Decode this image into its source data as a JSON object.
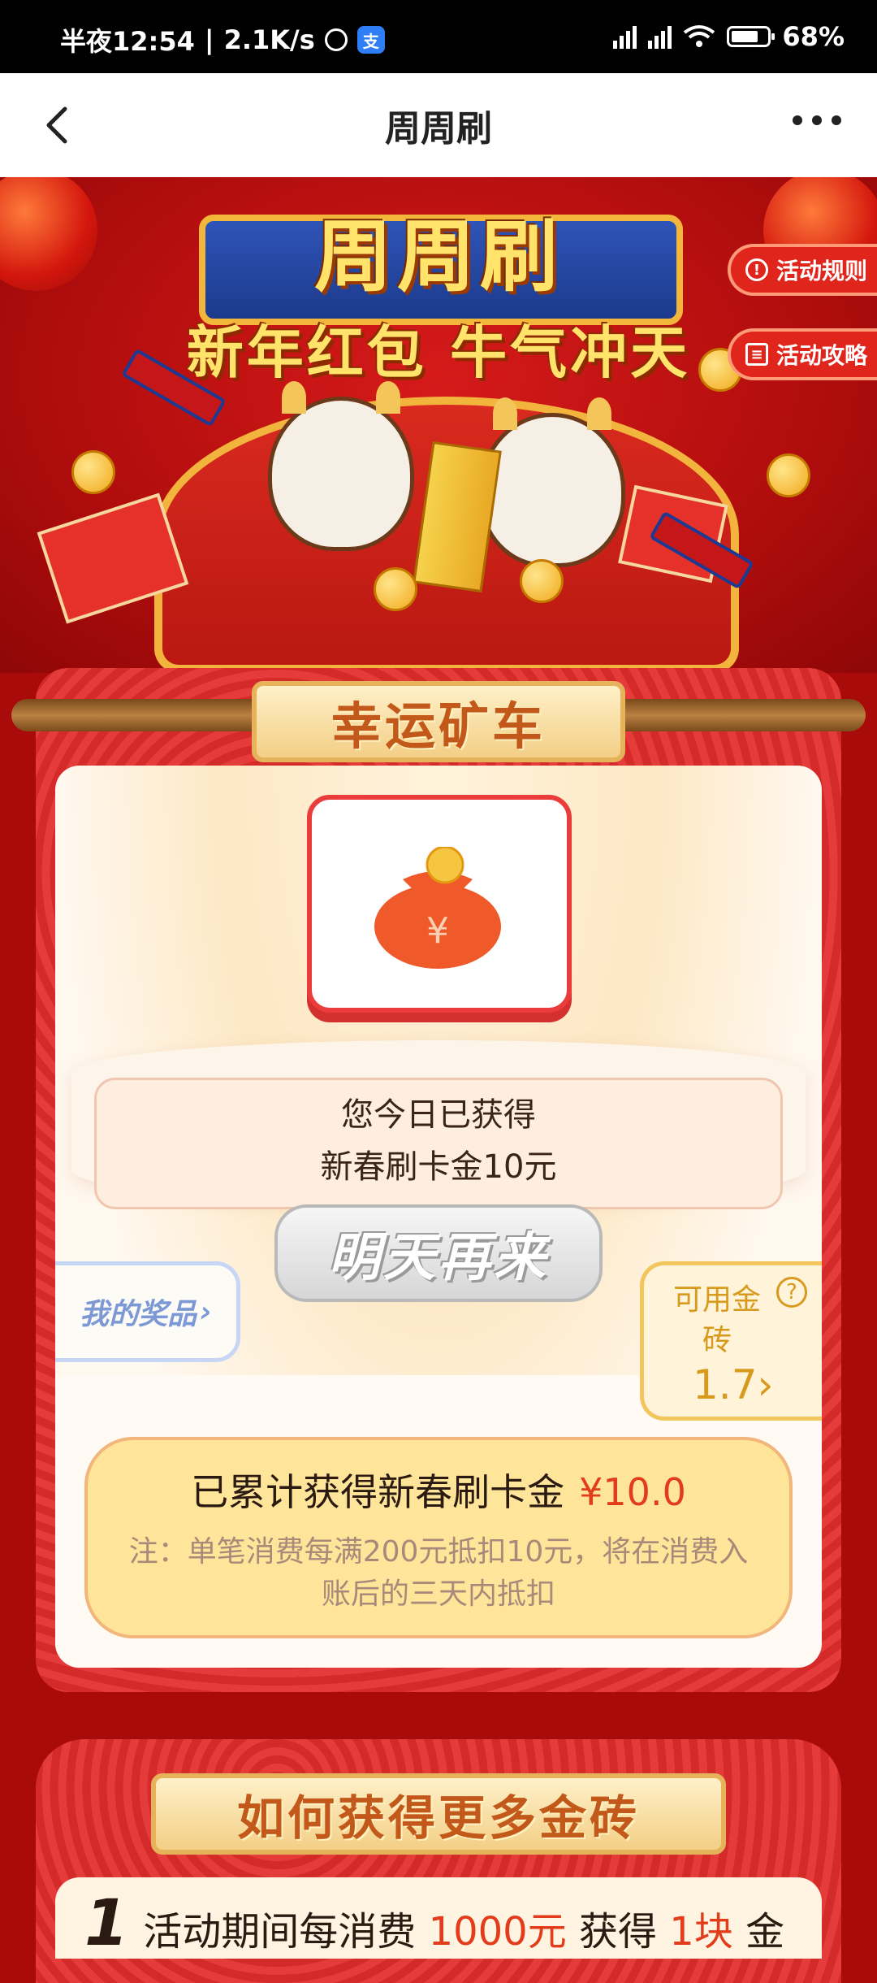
{
  "status_bar": {
    "time": "半夜12:54",
    "speed": "2.1K/s",
    "app_badge": "支",
    "battery": "68%",
    "icons": [
      "alarm-icon",
      "app-icon",
      "signal-hd-icon",
      "signal-hd-icon",
      "wifi-icon",
      "battery-icon"
    ]
  },
  "nav": {
    "title": "周周刷",
    "back_icon": "chevron-left-icon",
    "more_icon": "more-dots-icon"
  },
  "banner": {
    "title": "周周刷",
    "subtitle": "新年红包 牛气冲天",
    "rules_label": "活动规则",
    "strategy_label": "活动攻略",
    "colors": {
      "primary": "#d61a1a",
      "gold": "#ffe36a",
      "blue": "#2f54b8"
    }
  },
  "lucky_cart": {
    "plaque_title": "幸运矿车",
    "message_line1": "您今日已获得",
    "message_line2": "新春刷卡金10元",
    "tomorrow_button": "明天再来",
    "my_prizes_label": "我的奖品",
    "gold_label": "可用金砖",
    "gold_value": "1.7",
    "summary_label": "已累计获得新春刷卡金",
    "summary_amount": "¥10.0",
    "summary_note": "注：单笔消费每满200元抵扣10元，将在消费入账后的三天内抵扣"
  },
  "more_gold": {
    "plaque_title": "如何获得更多金砖",
    "step_number": "1",
    "step_text_a": "活动期间每消费",
    "step_highlight1": "1000元",
    "step_text_b": "获得",
    "step_highlight2": "1块",
    "step_text_c": "金"
  }
}
